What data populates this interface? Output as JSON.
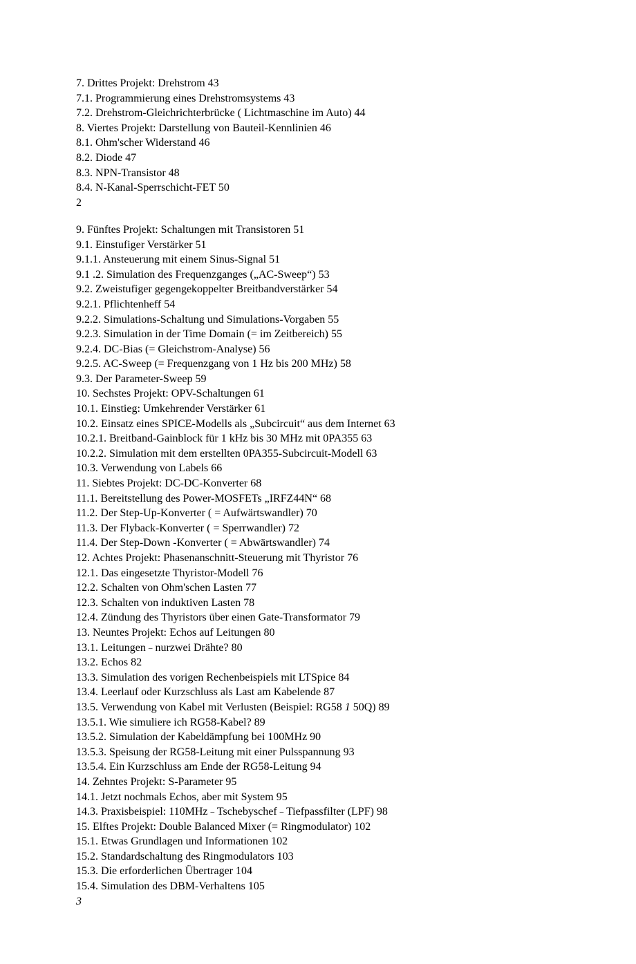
{
  "toc": {
    "block1": [
      "7. Drittes Projekt: Drehstrom 43",
      "7.1. Programmierung eines Drehstromsystems 43",
      "7.2. Drehstrom-Gleichrichterbrücke ( Lichtmaschine im Auto) 44",
      "8. Viertes Projekt: Darstellung von Bauteil-Kennlinien 46",
      "8.1. Ohm'scher Widerstand 46",
      "8.2. Diode 47",
      "8.3. NPN-Transistor 48",
      "8.4. N-Kanal-Sperrschicht-FET 50",
      "2"
    ],
    "block2": [
      "9. Fünftes Projekt: Schaltungen mit Transistoren 51",
      "9.1. Einstufiger Verstärker 51",
      "9.1.1. Ansteuerung mit einem Sinus-Signal 51",
      "9.1 .2. Simulation des Frequenzganges („AC-Sweep“) 53",
      "9.2. Zweistufiger gegengekoppelter Breitbandverstärker 54",
      "9.2.1. Pflichtenheff 54",
      "9.2.2. Simulations-Schaltung und Simulations-Vorgaben 55",
      "9.2.3. Simulation in der Time Domain (= im Zeitbereich) 55",
      "9.2.4. DC-Bias (= Gleichstrom-Analyse) 56",
      "9.2.5. AC-Sweep (= Frequenzgang von 1 Hz bis 200 MHz) 58",
      "9.3. Der Parameter-Sweep 59",
      "10. Sechstes Projekt: OPV-Schaltungen 61",
      "10.1. Einstieg: Umkehrender Verstärker 61",
      "10.2. Einsatz eines SPICE-Modells als „Subcircuit“ aus dem Internet 63",
      "10.2.1. Breitband-Gainblock für 1 kHz bis 30 MHz mit 0PA355 63",
      "10.2.2. Simulation mit dem erstellten 0PA355-Subcircuit-Modell 63",
      "10.3. Verwendung von Labels 66",
      "11. Siebtes Projekt: DC-DC-Konverter 68",
      "11.1. Bereitstellung des Power-MOSFETs „IRFZ44N“ 68",
      "11.2. Der Step-Up-Konverter ( = Aufwärtswandler) 70",
      "11.3. Der Flyback-Konverter ( = Sperrwandler) 72",
      "11.4. Der Step-Down -Konverter ( = Abwärtswandler) 74",
      "12. Achtes Projekt: Phasenanschnitt-Steuerung mit Thyristor 76",
      "12.1. Das eingesetzte Thyristor-Modell 76",
      "12.2. Schalten von Ohm'schen Lasten 77",
      "12.3. Schalten von induktiven Lasten 78",
      "12.4. Zündung des Thyristors über einen Gate-Transformator 79",
      "13. Neuntes Projekt: Echos auf Leitungen 80"
    ],
    "line_13_1_a": "13.1. Leitungen ",
    "line_13_1_b": "–",
    "line_13_1_c": " nurzwei Drähte? 80",
    "block3": [
      "13.2. Echos 82",
      "13.3. Simulation des vorigen Rechenbeispiels mit LTSpice 84",
      "13.4. Leerlauf oder Kurzschluss als Last am Kabelende 87"
    ],
    "line_13_5_a": "13.5. Verwendung von Kabel mit Verlusten (Beispiel: RG58 ",
    "line_13_5_b": "1",
    "line_13_5_c": " 50Q) 89",
    "block4": [
      "13.5.1. Wie simuliere ich RG58-Kabel? 89",
      "13.5.2. Simulation der Kabeldämpfung bei 100MHz 90",
      "13.5.3. Speisung der RG58-Leitung mit einer Pulsspannung 93",
      "13.5.4. Ein Kurzschluss am Ende der RG58-Leitung 94",
      "14. Zehntes Projekt: S-Parameter 95",
      "14.1. Jetzt nochmals Echos, aber mit System 95"
    ],
    "line_14_3_a": "14.3. Praxisbeispiel: 110MHz ",
    "line_14_3_b": "–",
    "line_14_3_c": " Tschebyschef ",
    "line_14_3_d": "–",
    "line_14_3_e": " Tiefpassfilter (LPF) 98",
    "block5": [
      "15. Elftes Projekt: Double Balanced Mixer (= Ringmodulator) 102",
      "15.1. Etwas Grundlagen und Informationen 102",
      "15.2. Standardschaltung des Ringmodulators 103",
      "15.3. Die erforderlichen Übertrager 104",
      "15.4. Simulation des DBM-Verhaltens 105"
    ],
    "page_marker": "3"
  }
}
